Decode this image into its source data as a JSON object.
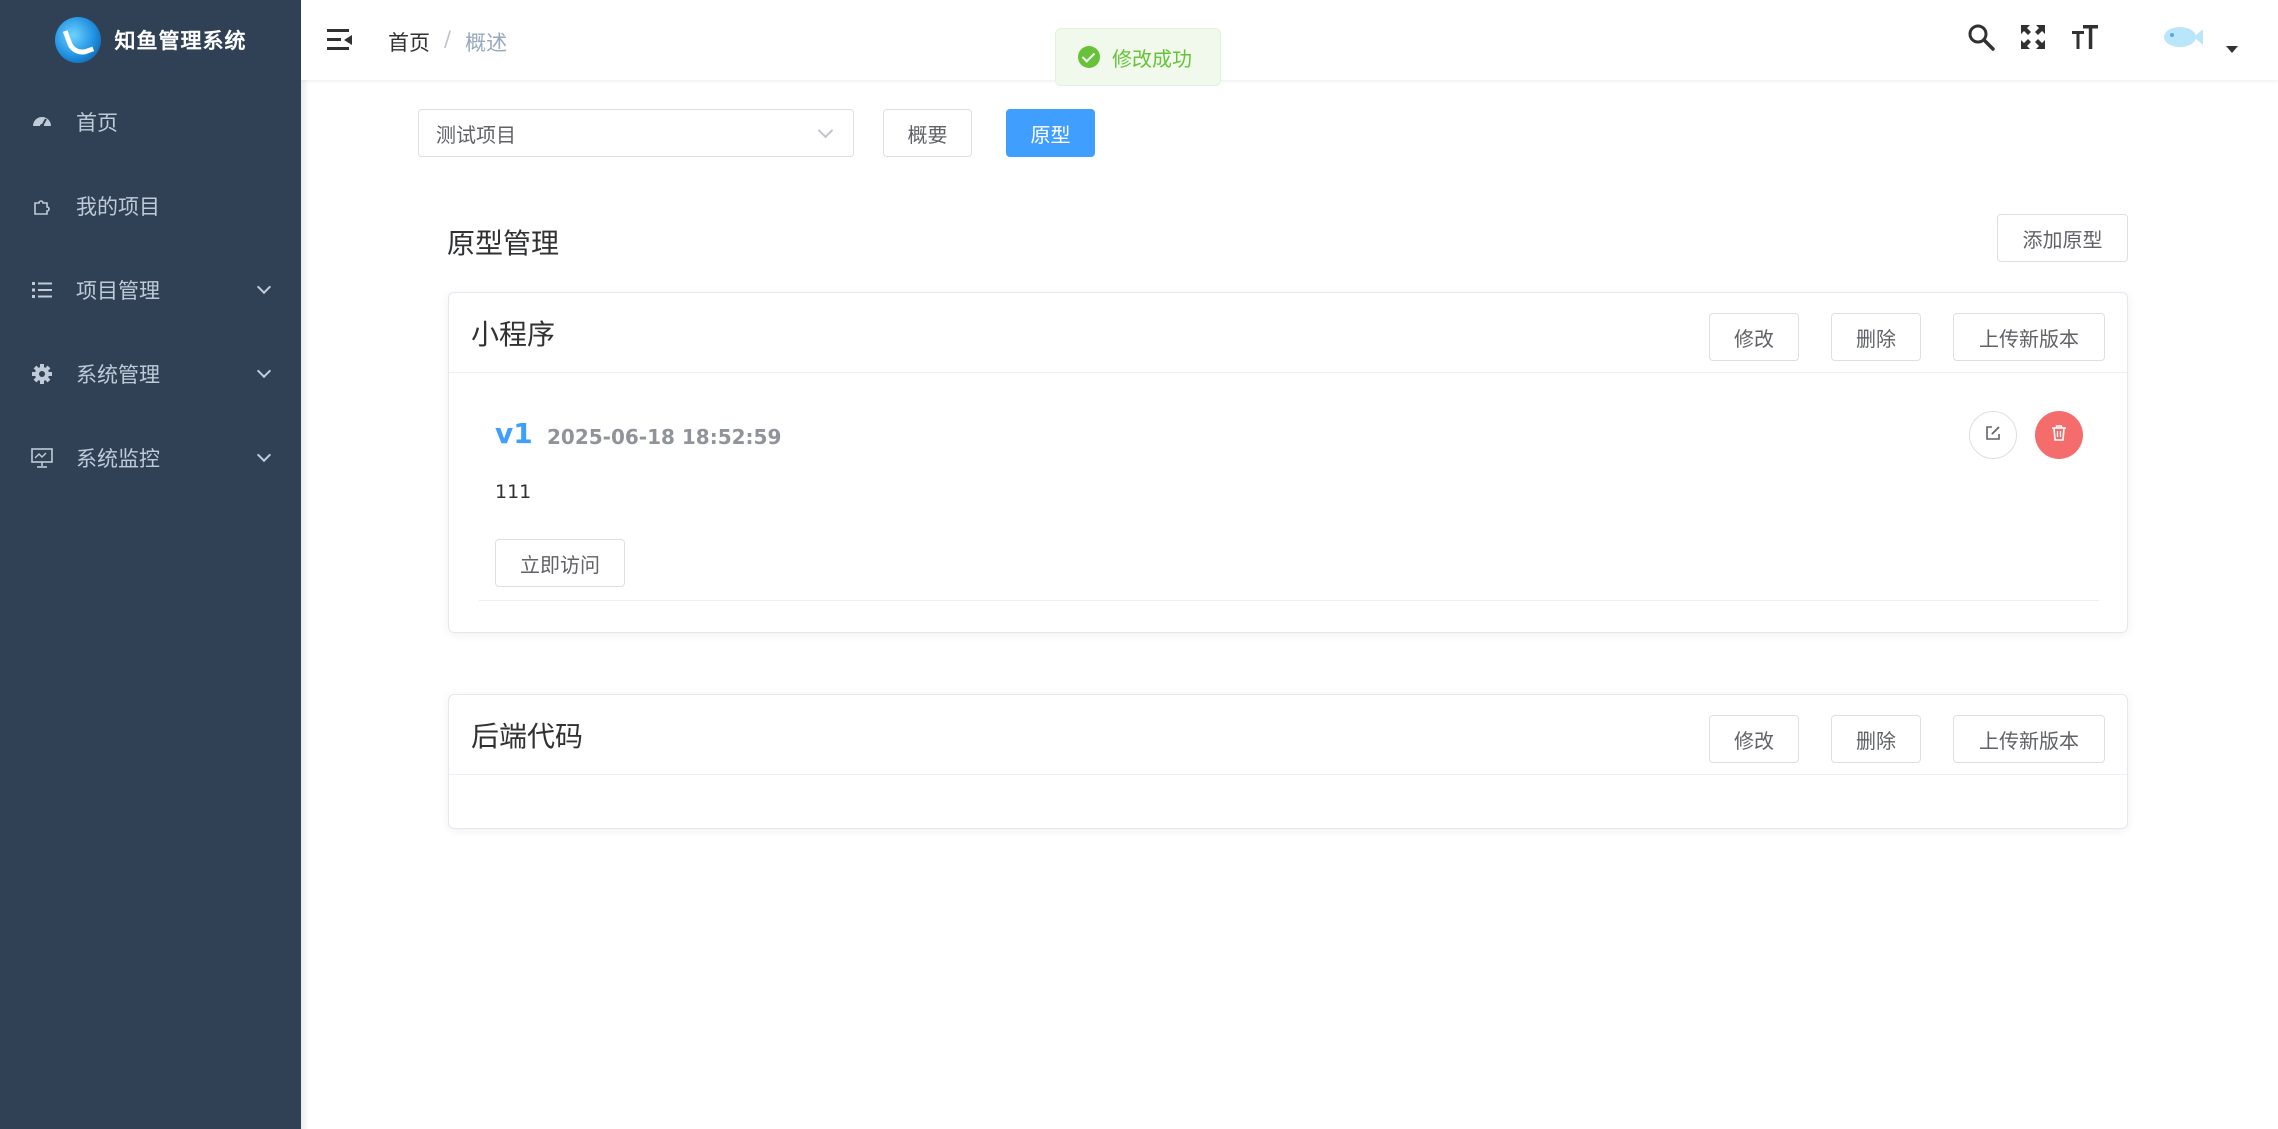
{
  "sidebar": {
    "app_name": "知鱼管理系统",
    "logo_icon": "fish-logo-icon",
    "items": [
      {
        "label": "首页",
        "icon": "dashboard-icon",
        "has_children": false
      },
      {
        "label": "我的项目",
        "icon": "puzzle-icon",
        "has_children": false
      },
      {
        "label": "项目管理",
        "icon": "list-icon",
        "has_children": true
      },
      {
        "label": "系统管理",
        "icon": "gear-icon",
        "has_children": true
      },
      {
        "label": "系统监控",
        "icon": "monitor-icon",
        "has_children": true
      }
    ],
    "bg_color": "#304156",
    "text_color": "#bfcbd9"
  },
  "navbar": {
    "breadcrumb": {
      "home": "首页",
      "separator": "/",
      "current": "概述"
    },
    "icons": [
      "search-icon",
      "fullscreen-icon",
      "font-size-icon"
    ],
    "avatar_icon": "fish-avatar-icon"
  },
  "toast": {
    "type": "success",
    "message": "修改成功",
    "color": "#67c23a"
  },
  "toolbar": {
    "project_select": {
      "value": "测试项目"
    },
    "overview_button": "概要",
    "prototype_button": "原型",
    "accent_color": "#409eff"
  },
  "main": {
    "section_title": "原型管理",
    "add_button": "添加原型",
    "cards": [
      {
        "title": "小程序",
        "edit_label": "修改",
        "delete_label": "删除",
        "upload_label": "上传新版本",
        "versions": [
          {
            "version": "v1",
            "time": "2025-06-18 18:52:59",
            "description": "111",
            "visit_label": "立即访问"
          }
        ]
      },
      {
        "title": "后端代码",
        "edit_label": "修改",
        "delete_label": "删除",
        "upload_label": "上传新版本",
        "versions": []
      }
    ]
  }
}
